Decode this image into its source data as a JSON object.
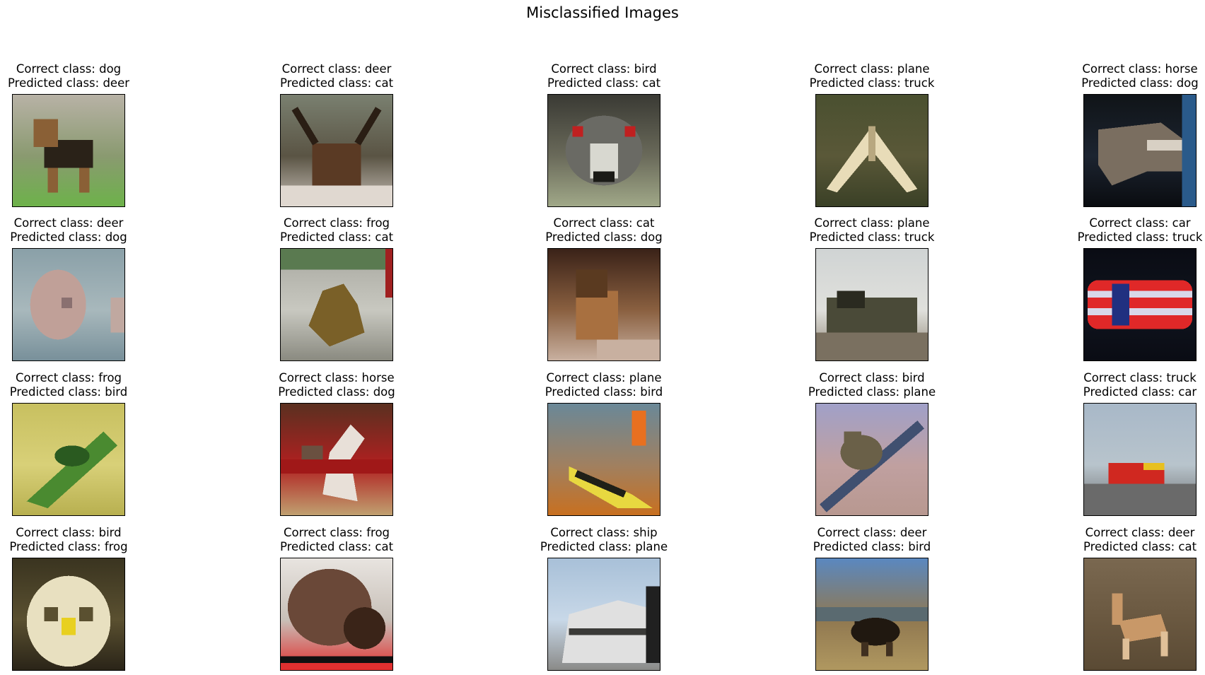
{
  "title": "Misclassified Images",
  "panels": [
    {
      "correct": "Correct class: dog",
      "predicted": "Predicted class: deer",
      "image": {
        "subject": "dog",
        "bg": [
          "#b8b2a6",
          "#8a9a70",
          "#6db24a"
        ],
        "fg": [
          "#2a2218",
          "#8a6036"
        ],
        "shape": "dog"
      }
    },
    {
      "correct": "Correct class: deer",
      "predicted": "Predicted class: cat",
      "image": {
        "subject": "deer",
        "bg": [
          "#7a8070",
          "#5a5444",
          "#c8c0b8"
        ],
        "fg": [
          "#5a3a24",
          "#2a1e14"
        ],
        "shape": "deer-head"
      }
    },
    {
      "correct": "Correct class: bird",
      "predicted": "Predicted class: cat",
      "image": {
        "subject": "bird",
        "bg": [
          "#3a3a34",
          "#6a6a5a",
          "#a0a888"
        ],
        "fg": [
          "#d8d8d0",
          "#1a1a16"
        ],
        "shape": "emu-face"
      }
    },
    {
      "correct": "Correct class: plane",
      "predicted": "Predicted class: truck",
      "image": {
        "subject": "plane",
        "bg": [
          "#4a5030",
          "#5a5838",
          "#3a4026"
        ],
        "fg": [
          "#e8dcb8",
          "#b8a880"
        ],
        "shape": "bomber"
      }
    },
    {
      "correct": "Correct class: horse",
      "predicted": "Predicted class: dog",
      "image": {
        "subject": "horse",
        "bg": [
          "#101418",
          "#1c2430",
          "#0a0c10"
        ],
        "fg": [
          "#7a6e60",
          "#d8d0c4"
        ],
        "shape": "horse-head"
      }
    },
    {
      "correct": "Correct class: deer",
      "predicted": "Predicted class: dog",
      "image": {
        "subject": "deer",
        "bg": [
          "#8aa0a8",
          "#a8b8bc",
          "#78909a"
        ],
        "fg": [
          "#c0a098",
          "#8a7070"
        ],
        "shape": "fawn"
      }
    },
    {
      "correct": "Correct class: frog",
      "predicted": "Predicted class: cat",
      "image": {
        "subject": "frog",
        "bg": [
          "#a8a8a0",
          "#c8c8c0",
          "#8a8a80"
        ],
        "fg": [
          "#7a6028",
          "#5a4818"
        ],
        "shape": "blob"
      }
    },
    {
      "correct": "Correct class: cat",
      "predicted": "Predicted class: dog",
      "image": {
        "subject": "cat",
        "bg": [
          "#3a2218",
          "#8a6040",
          "#c8b0a0"
        ],
        "fg": [
          "#a87040",
          "#5a3a20"
        ],
        "shape": "cat-sit"
      }
    },
    {
      "correct": "Correct class: plane",
      "predicted": "Predicted class: truck",
      "image": {
        "subject": "plane",
        "bg": [
          "#d0d4d4",
          "#e0e0dc",
          "#8a8070"
        ],
        "fg": [
          "#4a4a38",
          "#2a2a20"
        ],
        "shape": "wreck"
      }
    },
    {
      "correct": "Correct class: car",
      "predicted": "Predicted class: truck",
      "image": {
        "subject": "car",
        "bg": [
          "#0a0c14",
          "#10141e",
          "#0a0c14"
        ],
        "fg": [
          "#e02828",
          "#d8d8e8"
        ],
        "shape": "car-top"
      }
    },
    {
      "correct": "Correct class: frog",
      "predicted": "Predicted class: bird",
      "image": {
        "subject": "frog",
        "bg": [
          "#c8c060",
          "#d8d078",
          "#b8b050"
        ],
        "fg": [
          "#4a8a30",
          "#2a5a20"
        ],
        "shape": "leaf-frog"
      }
    },
    {
      "correct": "Correct class: horse",
      "predicted": "Predicted class: dog",
      "image": {
        "subject": "horse",
        "bg": [
          "#5a3020",
          "#b02020",
          "#c0a070"
        ],
        "fg": [
          "#e8e0d8",
          "#6a5040"
        ],
        "shape": "rearing"
      }
    },
    {
      "correct": "Correct class: plane",
      "predicted": "Predicted class: bird",
      "image": {
        "subject": "plane",
        "bg": [
          "#6a8898",
          "#a08060",
          "#c87020"
        ],
        "fg": [
          "#e8d840",
          "#202018"
        ],
        "shape": "jet-fire"
      }
    },
    {
      "correct": "Correct class: bird",
      "predicted": "Predicted class: plane",
      "image": {
        "subject": "bird",
        "bg": [
          "#a0a0c8",
          "#c0a0a0",
          "#b89890"
        ],
        "fg": [
          "#6a6048",
          "#405070"
        ],
        "shape": "perch"
      }
    },
    {
      "correct": "Correct class: truck",
      "predicted": "Predicted class: car",
      "image": {
        "subject": "truck",
        "bg": [
          "#a8b8c8",
          "#b8c4cc",
          "#6a6a6a"
        ],
        "fg": [
          "#d02820",
          "#e8c020"
        ],
        "shape": "firetruck"
      }
    },
    {
      "correct": "Correct class: bird",
      "predicted": "Predicted class: frog",
      "image": {
        "subject": "bird",
        "bg": [
          "#3a3420",
          "#5a5030",
          "#2a2418"
        ],
        "fg": [
          "#e8e0c0",
          "#e8d020"
        ],
        "shape": "owl"
      }
    },
    {
      "correct": "Correct class: frog",
      "predicted": "Predicted class: cat",
      "image": {
        "subject": "frog",
        "bg": [
          "#e8e4e0",
          "#c8c0b8",
          "#e03030"
        ],
        "fg": [
          "#6a4838",
          "#3a2418"
        ],
        "shape": "toad"
      }
    },
    {
      "correct": "Correct class: ship",
      "predicted": "Predicted class: plane",
      "image": {
        "subject": "ship",
        "bg": [
          "#a8c0d8",
          "#c8d8e8",
          "#8a8a88"
        ],
        "fg": [
          "#e0e0e0",
          "#3a3a38"
        ],
        "shape": "ship-bow"
      }
    },
    {
      "correct": "Correct class: deer",
      "predicted": "Predicted class: bird",
      "image": {
        "subject": "deer",
        "bg": [
          "#5a88c0",
          "#907850",
          "#b09860"
        ],
        "fg": [
          "#201810",
          "#403020"
        ],
        "shape": "buffalo"
      }
    },
    {
      "correct": "Correct class: deer",
      "predicted": "Predicted class: cat",
      "image": {
        "subject": "deer",
        "bg": [
          "#7a6850",
          "#6a5840",
          "#5a4a34"
        ],
        "fg": [
          "#c89868",
          "#e0c098"
        ],
        "shape": "deer-run"
      }
    }
  ]
}
